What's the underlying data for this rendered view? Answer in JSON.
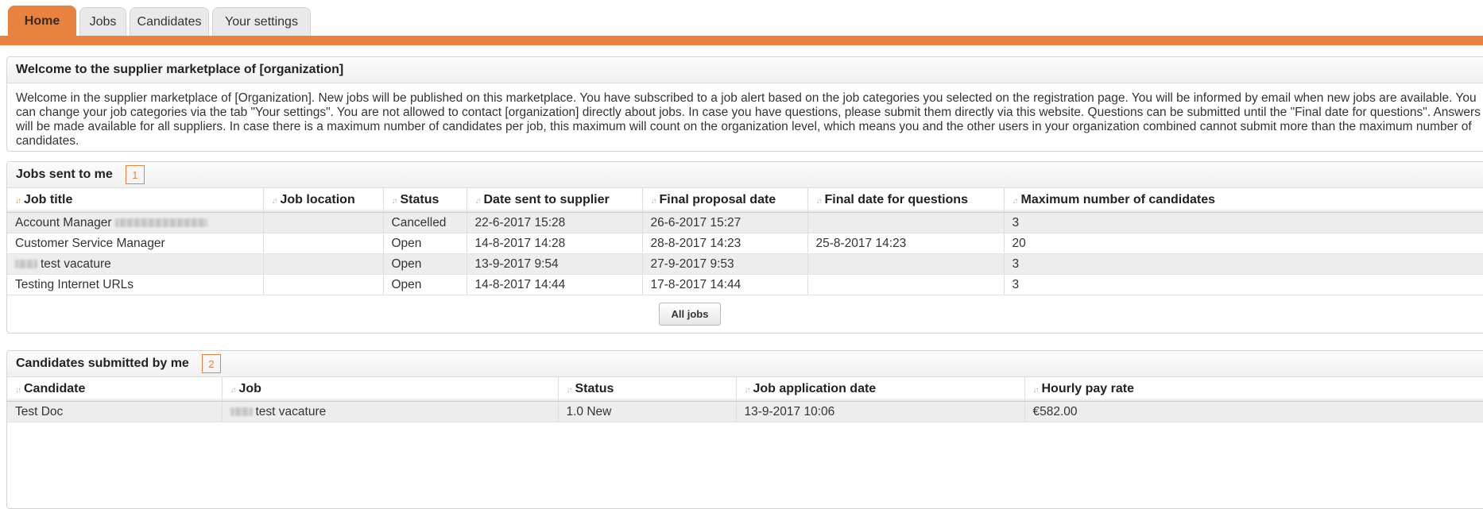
{
  "tabs": [
    {
      "label": "Home",
      "active": true
    },
    {
      "label": "Jobs",
      "active": false
    },
    {
      "label": "Candidates",
      "active": false
    },
    {
      "label": "Your settings",
      "active": false
    }
  ],
  "welcome": {
    "title": "Welcome to the supplier marketplace of [organization]",
    "text": "Welcome in the supplier marketplace of [Organization]. New jobs will be published on this marketplace. You have subscribed to a job alert based on the job categories you selected on the registration page. You will be informed by email when new jobs are available. You can change your job categories via the tab \"Your settings\". You are not allowed to contact [organization] directly about jobs. In case you have questions, please submit them directly via this website. Questions can be submitted until the \"Final date for questions\". Answers will be made available for all suppliers. In case there is a maximum number of candidates per job, this maximum will count on the organization level, which means you and the other users in your organization combined cannot submit more than the maximum number of candidates."
  },
  "jobs_panel": {
    "title": "Jobs sent to me",
    "count": "1",
    "columns": [
      "Job title",
      "Job location",
      "Status",
      "Date sent to supplier",
      "Final proposal date",
      "Final date for questions",
      "Maximum number of candidates"
    ],
    "rows": [
      {
        "title": "Account Manager",
        "location": "",
        "status": "Cancelled",
        "date_sent": "22-6-2017 15:28",
        "final_proposal": "26-6-2017 15:27",
        "final_questions": "",
        "max_candidates": "3"
      },
      {
        "title": "Customer Service Manager",
        "location": "",
        "status": "Open",
        "date_sent": "14-8-2017 14:28",
        "final_proposal": "28-8-2017 14:23",
        "final_questions": "25-8-2017 14:23",
        "max_candidates": "20"
      },
      {
        "title": "test vacature",
        "location": "",
        "status": "Open",
        "date_sent": "13-9-2017 9:54",
        "final_proposal": "27-9-2017 9:53",
        "final_questions": "",
        "max_candidates": "3"
      },
      {
        "title": "Testing Internet URLs",
        "location": "",
        "status": "Open",
        "date_sent": "14-8-2017 14:44",
        "final_proposal": "17-8-2017 14:44",
        "final_questions": "",
        "max_candidates": "3"
      }
    ],
    "all_button": "All jobs"
  },
  "candidates_panel": {
    "title": "Candidates submitted by me",
    "count": "2",
    "columns": [
      "Candidate",
      "Job",
      "Status",
      "Job application date",
      "Hourly pay rate"
    ],
    "rows": [
      {
        "candidate": "Test Doc",
        "job": "test vacature",
        "status": "1.0 New",
        "application_date": "13-9-2017 10:06",
        "pay_rate": "€582.00"
      }
    ]
  },
  "colors": {
    "accent": "#e8823e",
    "row_alt": "#ededed"
  }
}
